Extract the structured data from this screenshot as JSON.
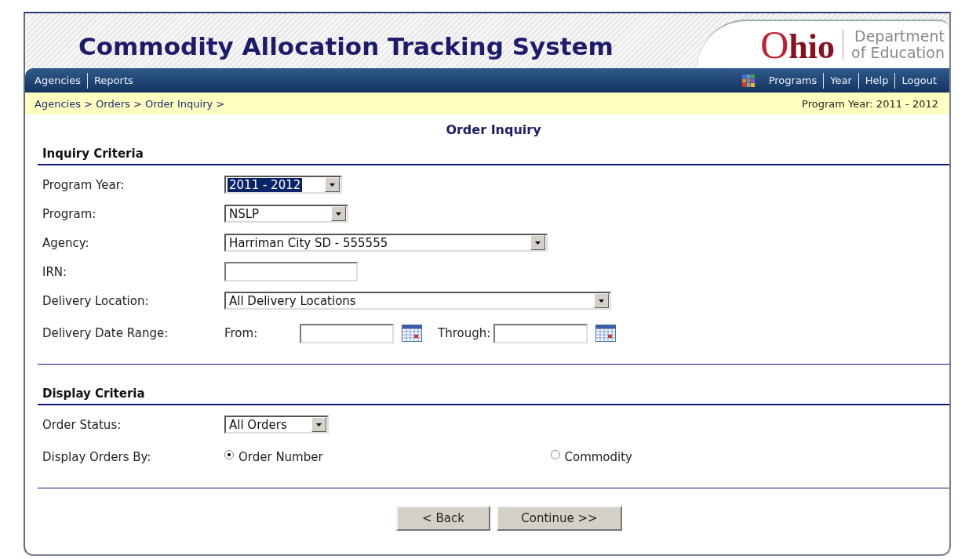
{
  "header": {
    "title": "Commodity Allocation Tracking System",
    "logo": {
      "name": "Ohio",
      "line1": "Department",
      "line2": "of Education"
    }
  },
  "nav_left": [
    "Agencies",
    "Reports"
  ],
  "nav_right": [
    "Programs",
    "Year",
    "Help",
    "Logout"
  ],
  "breadcrumb": "Agencies > Orders > Order Inquiry >",
  "program_year": "Program Year: 2011 - 2012",
  "page_title": "Order Inquiry",
  "sections": [
    {
      "title": "Inquiry Criteria",
      "fields": [
        {
          "kind": "select",
          "label": "Program Year:",
          "value": "2011 - 2012",
          "highlighted": true
        },
        {
          "kind": "select",
          "label": "Program:",
          "value": "NSLP",
          "highlighted": false
        },
        {
          "kind": "select",
          "label": "Agency:",
          "value": "Harriman City SD - 555555",
          "highlighted": false
        },
        {
          "kind": "text",
          "label": "IRN:"
        },
        {
          "kind": "select",
          "label": "Delivery Location:",
          "value": "All Delivery Locations",
          "highlighted": false
        },
        {
          "kind": "daterange",
          "label": "Delivery Date Range:",
          "from_label": "From:",
          "through_label": "Through:"
        }
      ]
    },
    {
      "title": "Display Criteria",
      "fields": [
        {
          "kind": "select",
          "label": "Order Status:",
          "value": "All Orders",
          "highlighted": false
        },
        {
          "kind": "radio",
          "label": "Display Orders By:",
          "options": [
            {
              "label": "Order Number",
              "selected": true
            },
            {
              "label": "Commodity",
              "selected": false
            }
          ]
        }
      ]
    }
  ],
  "buttons": [
    "< Back",
    "Continue >>"
  ]
}
